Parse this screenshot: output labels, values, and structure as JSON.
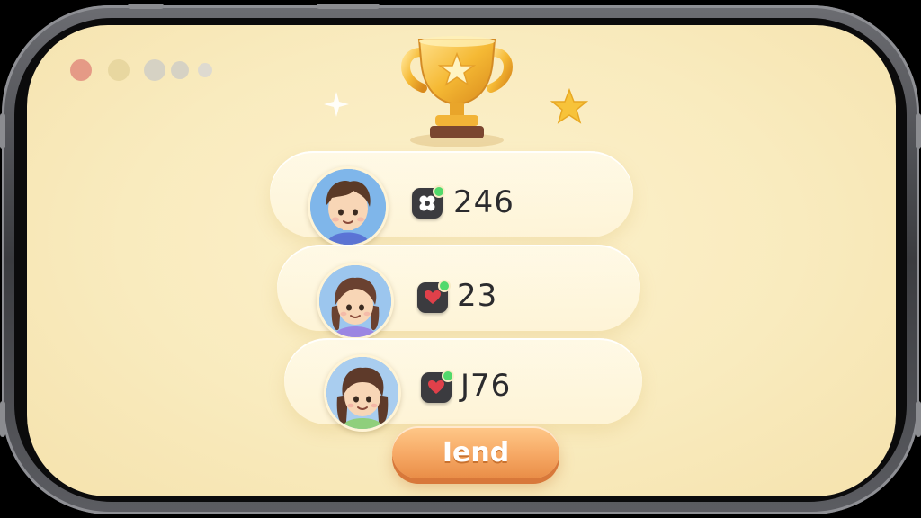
{
  "window_dots": [
    {
      "color": "#e59a86"
    },
    {
      "color": "#e8d7a0"
    },
    {
      "color": "#d6d2c4"
    },
    {
      "color": "#d6d2c4"
    },
    {
      "color": "#dedad0"
    }
  ],
  "trophy": {
    "icon": "trophy-icon",
    "color": "#f5b934"
  },
  "leaderboard": [
    {
      "avatar": "boy-avatar",
      "badge_icon": "clover-icon",
      "score": "246"
    },
    {
      "avatar": "girl-avatar",
      "badge_icon": "heart-icon",
      "score": "23"
    },
    {
      "avatar": "girl-avatar",
      "badge_icon": "heart-icon",
      "score": "J76"
    }
  ],
  "send_button": {
    "label": "Iend"
  },
  "colors": {
    "background": "#f9ebbe",
    "button": "#f6a864",
    "badge": "#3b3b3f",
    "online": "#52d96b",
    "heart": "#e0404a"
  }
}
